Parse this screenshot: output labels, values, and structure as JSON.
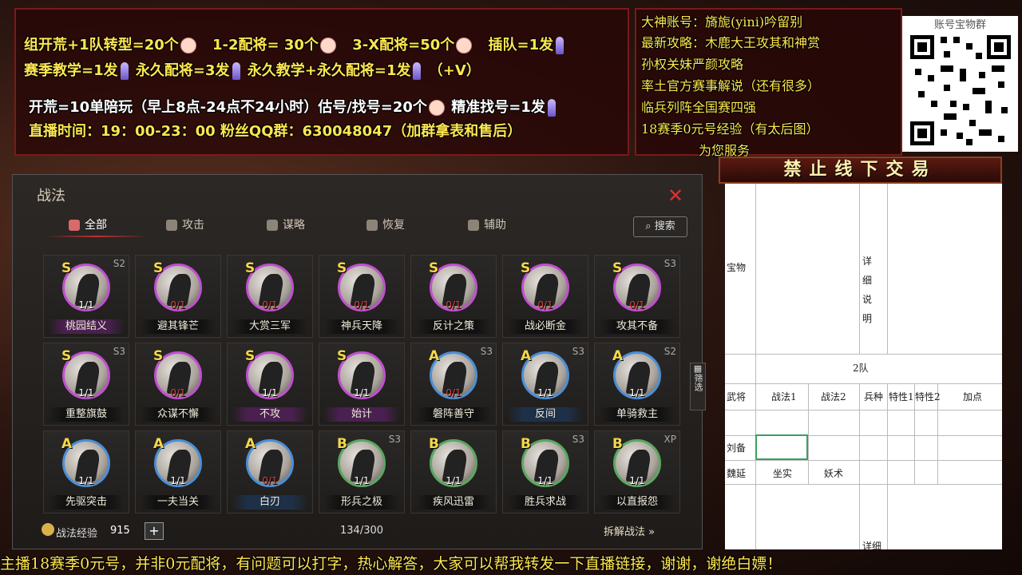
{
  "promo": {
    "line1": [
      "组开荒+1队转型=20个",
      "1-2配将= 30个",
      "3-X配将=50个",
      "插队=1发"
    ],
    "line2": [
      "赛季教学=1发",
      "永久配将=3发",
      "永久教学+永久配将=1发",
      "（+V）"
    ],
    "line3": [
      "开荒=10单陪玩（早上8点-24点不24小时）估号/找号=20个",
      "精准找号=1发"
    ],
    "line4": "直播时间：19：00-23：00   粉丝QQ群：630048047（加群拿表和售后）"
  },
  "side": [
    "大神账号：旖旎(yini)吟留别",
    "最新攻略：木鹿大王攻其和神赏",
    "孙权关妹严颜攻略",
    "率土官方赛事解说（还有很多）",
    "临兵列阵全国赛四强",
    "18赛季0元号经验（有太后图）",
    "为您服务"
  ],
  "qr": {
    "title": "账号宝物群"
  },
  "banner": "禁止线下交易",
  "sheet": {
    "treasure": "宝物",
    "detail": "详细说明",
    "team": "2队",
    "headers": [
      "武将",
      "战法1",
      "战法2",
      "兵种",
      "特性1",
      "特性2",
      "加点"
    ],
    "rows": [
      [
        "刘备",
        "",
        "",
        "",
        "",
        "",
        ""
      ],
      [
        "魏延",
        "坐实",
        "妖术",
        "",
        "",
        "",
        ""
      ]
    ],
    "detail2": "详细"
  },
  "game": {
    "title": "战法",
    "tabs": [
      "全部",
      "攻击",
      "谋略",
      "恢复",
      "辅助"
    ],
    "search": "搜索",
    "filter": "筛选",
    "skills": [
      {
        "grade": "S",
        "season": "S2",
        "count": "1/1",
        "name": "桃园结义",
        "zero": false,
        "style": "pur"
      },
      {
        "grade": "S",
        "season": "",
        "count": "0/1",
        "name": "避其锋芒",
        "zero": true,
        "style": ""
      },
      {
        "grade": "S",
        "season": "",
        "count": "0/1",
        "name": "大赏三军",
        "zero": true,
        "style": ""
      },
      {
        "grade": "S",
        "season": "",
        "count": "0/1",
        "name": "神兵天降",
        "zero": true,
        "style": ""
      },
      {
        "grade": "S",
        "season": "",
        "count": "0/1",
        "name": "反计之策",
        "zero": true,
        "style": ""
      },
      {
        "grade": "S",
        "season": "",
        "count": "0/1",
        "name": "战必断金",
        "zero": true,
        "style": ""
      },
      {
        "grade": "S",
        "season": "S3",
        "count": "0/1",
        "name": "攻其不备",
        "zero": true,
        "style": ""
      },
      {
        "grade": "S",
        "season": "S3",
        "count": "1/1",
        "name": "重整旗鼓",
        "zero": false,
        "style": ""
      },
      {
        "grade": "S",
        "season": "",
        "count": "0/1",
        "name": "众谋不懈",
        "zero": true,
        "style": ""
      },
      {
        "grade": "S",
        "season": "",
        "count": "1/1",
        "name": "不攻",
        "zero": false,
        "style": "pur"
      },
      {
        "grade": "S",
        "season": "",
        "count": "1/1",
        "name": "始计",
        "zero": false,
        "style": "pur"
      },
      {
        "grade": "A",
        "season": "S3",
        "count": "0/1",
        "name": "磐阵善守",
        "zero": true,
        "style": ""
      },
      {
        "grade": "A",
        "season": "S3",
        "count": "1/1",
        "name": "反间",
        "zero": false,
        "style": "blu"
      },
      {
        "grade": "A",
        "season": "S2",
        "count": "1/1",
        "name": "单骑救主",
        "zero": false,
        "style": ""
      },
      {
        "grade": "A",
        "season": "",
        "count": "1/1",
        "name": "先驱突击",
        "zero": false,
        "style": ""
      },
      {
        "grade": "A",
        "season": "",
        "count": "1/1",
        "name": "一夫当关",
        "zero": false,
        "style": ""
      },
      {
        "grade": "A",
        "season": "",
        "count": "0/1",
        "name": "白刃",
        "zero": true,
        "style": "blu"
      },
      {
        "grade": "B",
        "season": "S3",
        "count": "1/1",
        "name": "形兵之极",
        "zero": false,
        "style": ""
      },
      {
        "grade": "B",
        "season": "",
        "count": "1/1",
        "name": "疾风迅雷",
        "zero": false,
        "style": ""
      },
      {
        "grade": "B",
        "season": "S3",
        "count": "1/1",
        "name": "胜兵求战",
        "zero": false,
        "style": ""
      },
      {
        "grade": "B",
        "season": "XP",
        "count": "1/1",
        "name": "以直报怨",
        "zero": false,
        "style": ""
      }
    ],
    "exp_label": "战法经验",
    "exp_value": "915",
    "plus": "+",
    "capacity": "134/300",
    "decompose": "拆解战法 »"
  },
  "ticker": "主播18赛季0元号，并非0元配将，有问题可以打字，热心解答，大家可以帮我转发一下直播链接，谢谢，谢绝白嫖！"
}
